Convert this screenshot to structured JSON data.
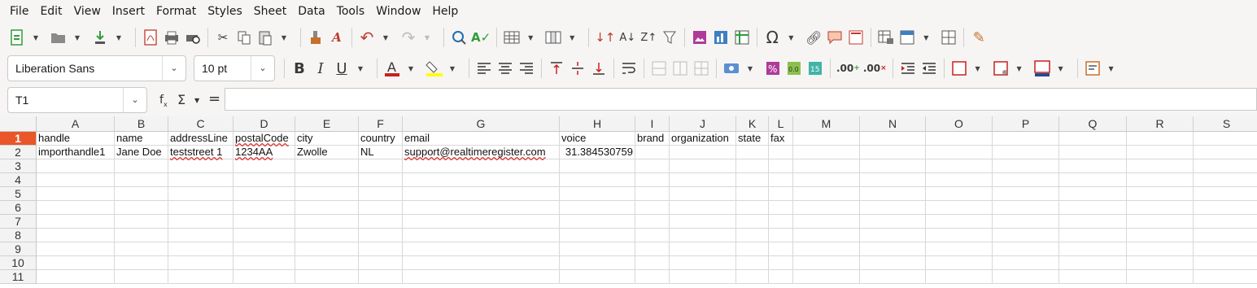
{
  "menubar": {
    "items": [
      "File",
      "Edit",
      "View",
      "Insert",
      "Format",
      "Styles",
      "Sheet",
      "Data",
      "Tools",
      "Window",
      "Help"
    ]
  },
  "format_bar": {
    "font_name": "Liberation Sans",
    "font_size": "10 pt"
  },
  "formula_bar": {
    "name_box": "T1",
    "formula": ""
  },
  "columns": [
    "A",
    "B",
    "C",
    "D",
    "E",
    "F",
    "G",
    "H",
    "I",
    "J",
    "K",
    "L",
    "M",
    "N",
    "O",
    "P",
    "Q",
    "R",
    "S"
  ],
  "rows": [
    "1",
    "2",
    "3",
    "4",
    "5",
    "6",
    "7",
    "8",
    "9",
    "10",
    "11"
  ],
  "headers": [
    "handle",
    "name",
    "addressLine",
    "postalCode",
    "city",
    "country",
    "email",
    "voice",
    "brand",
    "organization",
    "state",
    "fax"
  ],
  "record": [
    "importhandle1",
    "Jane Doe",
    "teststreet 1",
    "1234AA",
    "Zwolle",
    "NL",
    "support@realtimeregister.com",
    "31.384530759",
    "",
    "",
    "",
    ""
  ],
  "colors": {
    "active_row": "#e8562a",
    "accent_green": "#2e9d3a"
  }
}
